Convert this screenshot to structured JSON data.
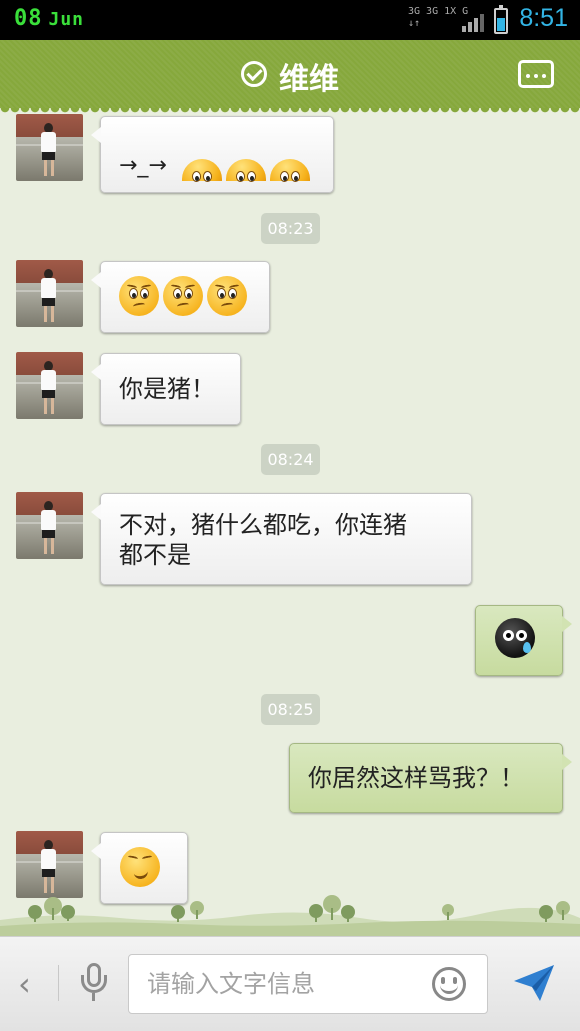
{
  "status_bar": {
    "day": "08",
    "month": "Jun",
    "network_top": "3G 3G 1X G",
    "network_bottom": "↓↑",
    "time": "8:51"
  },
  "header": {
    "title": "维维",
    "verified_icon": "check-circle-icon",
    "more_icon": "more-icon"
  },
  "messages": [
    {
      "side": "in",
      "text": "→_→",
      "emoji": [
        "bored-face",
        "bored-face",
        "bored-face"
      ]
    },
    {
      "type": "time",
      "text": "08:23"
    },
    {
      "side": "in",
      "emoji": [
        "puzzled-face",
        "puzzled-face",
        "puzzled-face"
      ]
    },
    {
      "side": "in",
      "text": "你是猪！"
    },
    {
      "type": "time",
      "text": "08:24"
    },
    {
      "side": "in",
      "text_line1": "不对，猪什么都吃，你连猪",
      "text_line2": "都不是"
    },
    {
      "side": "out",
      "emoji": [
        "crying-bomb"
      ]
    },
    {
      "type": "time",
      "text": "08:25"
    },
    {
      "side": "out",
      "text": "你居然这样骂我？！"
    },
    {
      "side": "in",
      "emoji": [
        "laughing-face"
      ]
    }
  ],
  "input_bar": {
    "placeholder": "请输入文字信息",
    "back_icon": "chevron-left-icon",
    "voice_icon": "microphone-icon",
    "emoji_icon": "smiley-icon",
    "send_icon": "send-icon"
  },
  "colors": {
    "header": "#86a83c",
    "background": "#e9eedf",
    "outgoing_bubble": "#c7db9f",
    "timestamp_badge": "#ccd3c5",
    "status_time": "#33b5e5",
    "status_date": "#3adf3a"
  }
}
